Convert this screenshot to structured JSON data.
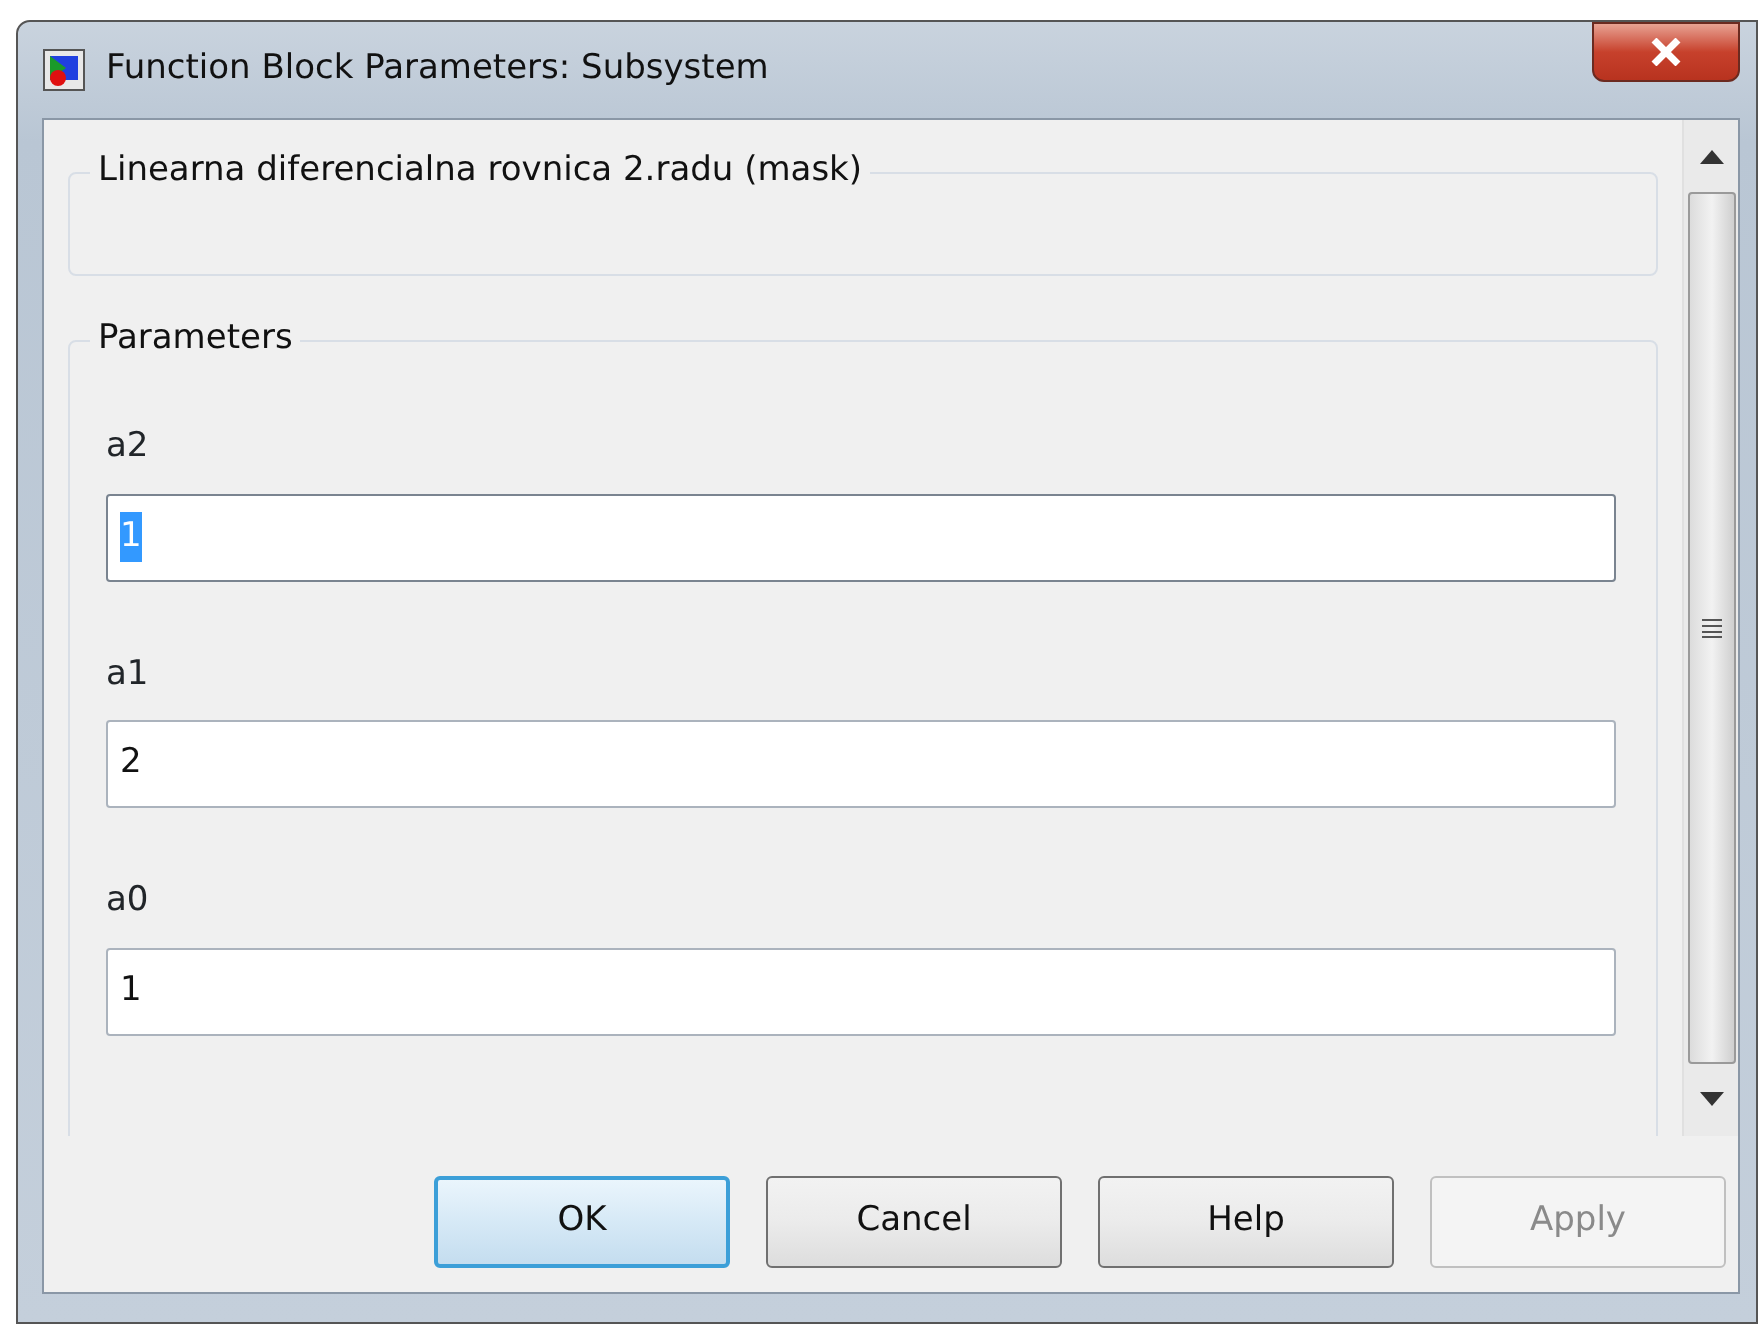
{
  "window": {
    "title": "Function Block Parameters: Subsystem"
  },
  "mask": {
    "title": "Linearna diferencialna rovnica 2.radu (mask)"
  },
  "parameters": {
    "title": "Parameters",
    "fields": [
      {
        "label": "a2",
        "value": "1",
        "focused": true
      },
      {
        "label": "a1",
        "value": "2",
        "focused": false
      },
      {
        "label": "a0",
        "value": "1",
        "focused": false
      }
    ]
  },
  "buttons": [
    {
      "label": "OK",
      "default": true,
      "disabled": false
    },
    {
      "label": "Cancel",
      "default": false,
      "disabled": false
    },
    {
      "label": "Help",
      "default": false,
      "disabled": false
    },
    {
      "label": "Apply",
      "default": false,
      "disabled": true
    }
  ]
}
